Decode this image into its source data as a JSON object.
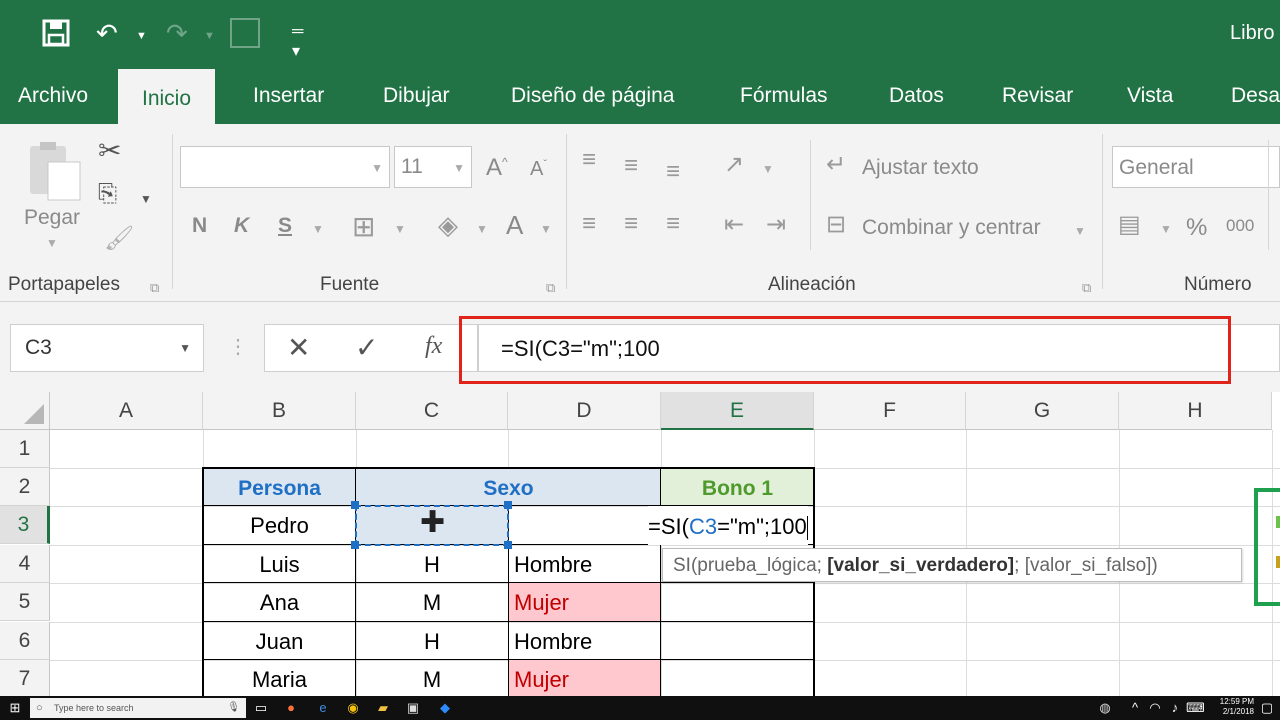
{
  "title_bar": {
    "book_title": "Libro"
  },
  "tabs": [
    {
      "label": "Archivo"
    },
    {
      "label": "Inicio"
    },
    {
      "label": "Insertar"
    },
    {
      "label": "Dibujar"
    },
    {
      "label": "Diseño de página"
    },
    {
      "label": "Fórmulas"
    },
    {
      "label": "Datos"
    },
    {
      "label": "Revisar"
    },
    {
      "label": "Vista"
    },
    {
      "label": "Desa"
    }
  ],
  "ribbon": {
    "clipboard": {
      "label": "Portapapeles",
      "paste": "Pegar"
    },
    "font": {
      "label": "Fuente",
      "name": "",
      "size": "11",
      "bold": "N",
      "italic": "K",
      "underline": "S"
    },
    "alignment": {
      "label": "Alineación",
      "wrap_text": "Ajustar texto",
      "merge_center": "Combinar y centrar"
    },
    "number": {
      "label": "Número",
      "format": "General",
      "percent": "%",
      "thousands": "000"
    }
  },
  "formula_bar": {
    "name_box": "C3",
    "formula": "=SI(C3=\"m\";100",
    "fx": "fx"
  },
  "columns": [
    "A",
    "B",
    "C",
    "D",
    "E",
    "F",
    "G",
    "H"
  ],
  "rows": [
    "1",
    "2",
    "3",
    "4",
    "5",
    "6",
    "7"
  ],
  "table": {
    "headers": {
      "persona": "Persona",
      "sexo": "Sexo",
      "bono": "Bono 1"
    },
    "rows": [
      {
        "persona": "Pedro",
        "code": "",
        "label": ""
      },
      {
        "persona": "Luis",
        "code": "H",
        "label": "Hombre"
      },
      {
        "persona": "Ana",
        "code": "M",
        "label": "Mujer"
      },
      {
        "persona": "Juan",
        "code": "H",
        "label": "Hombre"
      },
      {
        "persona": "Maria",
        "code": "M",
        "label": "Mujer"
      }
    ],
    "editing_cell": {
      "prefix": "=SI(",
      "ref": "C3",
      "suffix": "=\"m\";100"
    }
  },
  "tooltip": {
    "fn": "SI(prueba_lógica; ",
    "bold_arg": "[valor_si_verdadero]",
    "rest": "; [valor_si_falso])"
  },
  "colors": {
    "excel_green": "#217346",
    "header_blue_text": "#1f6fc5",
    "header_blue_fill": "#dce6f1",
    "bono_green_text": "#4e9a2c",
    "bono_green_fill": "#e2efd9",
    "mujer_fill": "#ffc7ce",
    "mujer_text": "#c00000",
    "highlight_red": "#e0241a"
  },
  "taskbar": {
    "search_placeholder": "Type here to search",
    "time": "12:59 PM",
    "date": "2/1/2018"
  }
}
